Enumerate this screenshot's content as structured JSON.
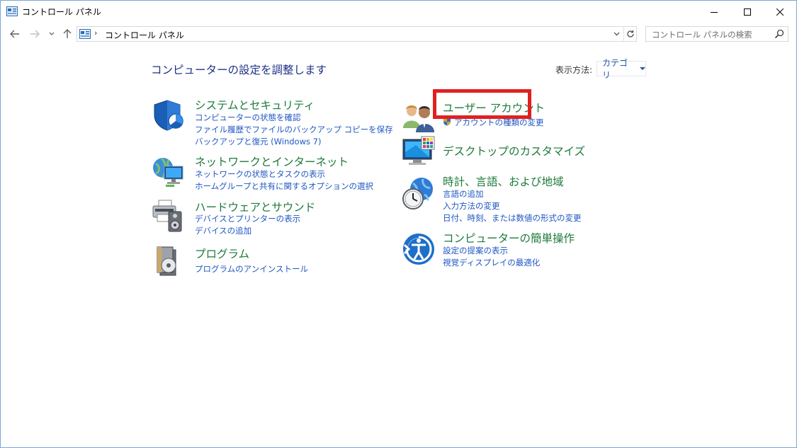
{
  "window": {
    "title": "コントロール パネル",
    "controls": [
      "minimize-icon",
      "maximize-icon",
      "close-icon"
    ]
  },
  "address_bar": {
    "path_separator": "›",
    "path": "コントロール パネル",
    "search_placeholder": "コントロール パネルの検索"
  },
  "content": {
    "heading": "コンピューターの設定を調整します",
    "view_by_label": "表示方法:",
    "view_by_value": "カテゴリ"
  },
  "categories": {
    "system": {
      "title": "システムとセキュリティ",
      "links": [
        "コンピューターの状態を確認",
        "ファイル履歴でファイルのバックアップ コピーを保存",
        "バックアップと復元 (Windows 7)"
      ]
    },
    "network": {
      "title": "ネットワークとインターネット",
      "links": [
        "ネットワークの状態とタスクの表示",
        "ホームグループと共有に関するオプションの選択"
      ]
    },
    "hardware": {
      "title": "ハードウェアとサウンド",
      "links": [
        "デバイスとプリンターの表示",
        "デバイスの追加"
      ]
    },
    "programs": {
      "title": "プログラム",
      "links": [
        "プログラムのアンインストール"
      ]
    },
    "user_accounts": {
      "title": "ユーザー アカウント",
      "links": [
        "アカウントの種類の変更"
      ]
    },
    "appearance": {
      "title": "デスクトップのカスタマイズ",
      "links": []
    },
    "clock": {
      "title": "時計、言語、および地域",
      "links": [
        "言語の追加",
        "入力方法の変更",
        "日付、時刻、または数値の形式の変更"
      ]
    },
    "ease": {
      "title": "コンピューターの簡単操作",
      "links": [
        "設定の提案の表示",
        "視覚ディスプレイの最適化"
      ]
    }
  },
  "colors": {
    "heading": "#1e3287",
    "category_title": "#1c7a3a",
    "link": "#1e57c4",
    "highlight": "#e02020"
  }
}
